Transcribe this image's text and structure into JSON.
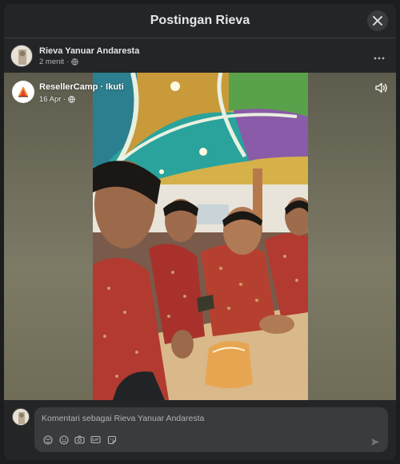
{
  "modal": {
    "title": "Postingan Rieva"
  },
  "post": {
    "author_name": "Rieva Yanuar Andaresta",
    "time": "2 menit",
    "privacy_icon": "globe-icon",
    "more_icon": "more-dots-icon"
  },
  "shared": {
    "source_name": "ResellerCamp · Ikuti",
    "date": "16 Apr ·",
    "sound_icon": "speaker-icon"
  },
  "comment": {
    "placeholder": "Komentari sebagai Rieva Yanuar Andaresta",
    "tools": [
      "avatar-sticker-icon",
      "emoji-icon",
      "camera-icon",
      "gif-icon",
      "sticker-icon"
    ],
    "send_icon": "send-icon"
  },
  "colors": {
    "background": "#242526",
    "text": "#e4e6eb",
    "muted": "#b0b3b8",
    "input": "#3a3b3c"
  }
}
